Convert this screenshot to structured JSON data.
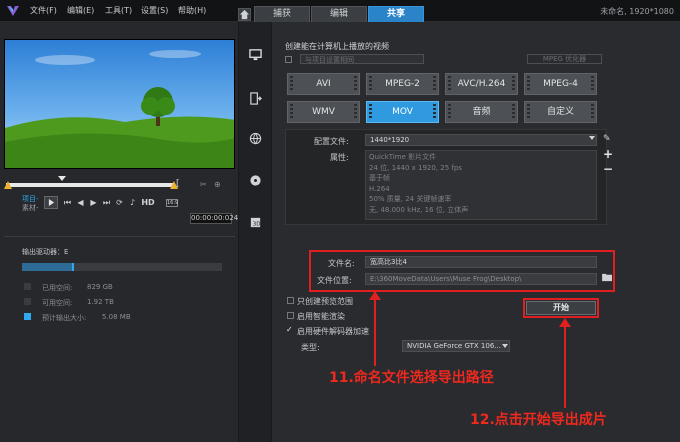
{
  "titlebar": {
    "menu": [
      "文件(F)",
      "编辑(E)",
      "工具(T)",
      "设置(S)",
      "帮助(H)"
    ],
    "project": "未命名, 1920*1080"
  },
  "tabs": [
    "捕获",
    "编辑",
    "共享"
  ],
  "player": {
    "project_label": "项目-",
    "clip_label": "素材-",
    "hd": "HD",
    "timecode": "00:00:00:024",
    "speed": "16:9"
  },
  "drive": {
    "label": "输出驱动器：E",
    "legend": [
      {
        "label": "已用空间:",
        "value": "829 GB",
        "color": "#3a3c40"
      },
      {
        "label": "可用空间:",
        "value": "1.92 TB",
        "color": "#3a3c40"
      },
      {
        "label": "预计输出大小:",
        "value": "5.08 MB",
        "color": "#2ea8ee"
      }
    ]
  },
  "share": {
    "heading": "创建能在计算机上播放的视频",
    "device_select": "与项目设置相同",
    "mpeg_opt": "MPEG 优化器",
    "formats": [
      "AVI",
      "MPEG-2",
      "AVC/H.264",
      "MPEG-4",
      "WMV",
      "MOV",
      "音频",
      "自定义"
    ],
    "profile_label": "配置文件:",
    "profile_value": "1440*1920",
    "props_label": "属性:",
    "props": [
      "QuickTime 影片文件",
      "24 位, 1440 x 1920, 25 fps",
      "基于帧",
      "H.264",
      "50% 质量, 24 关键帧速率",
      "无, 48.000 kHz, 16 位, 立体声"
    ],
    "filename_label": "文件名:",
    "filename_value": "宽高比3比4",
    "location_label": "文件位置:",
    "location_value": "E:\\360MoveData\\Users\\Muse Frog\\Desktop\\",
    "options": [
      "只创建预览范围",
      "启用智能渲染",
      "启用硬件解码器加速"
    ],
    "type_label": "类型:",
    "gpu_value": "NVIDIA GeForce GTX 106...",
    "start": "开始"
  },
  "annotations": {
    "a11": "11.命名文件选择导出路径",
    "a12": "12.点击开始导出成片"
  }
}
